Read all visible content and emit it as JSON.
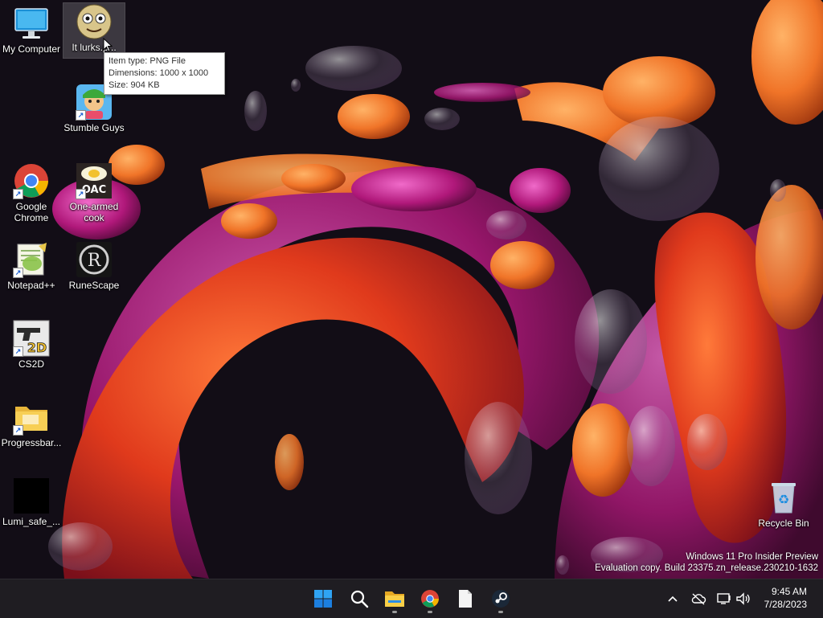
{
  "desktop": {
    "icons": [
      {
        "label": "My Computer"
      },
      {
        "label": "It lurks.p..."
      },
      {
        "label": "Stumble Guys"
      },
      {
        "label": "Google Chrome"
      },
      {
        "label": "One-armed cook"
      },
      {
        "label": "Notepad++"
      },
      {
        "label": "RuneScape"
      },
      {
        "label": "CS2D"
      },
      {
        "label": "Progressbar..."
      },
      {
        "label": "Lumi_safe_..."
      },
      {
        "label": "Recycle Bin"
      }
    ],
    "tooltip": {
      "line1": "Item type: PNG File",
      "line2": "Dimensions: 1000 x 1000",
      "line3": "Size: 904 KB"
    },
    "watermark": {
      "line1": "Windows 11 Pro Insider Preview",
      "line2": "Evaluation copy. Build 23375.zn_release.230210-1632"
    }
  },
  "taskbar": {
    "apps": [
      "start-icon",
      "search-icon",
      "file-explorer-icon",
      "chrome-icon",
      "notepad-icon",
      "steam-icon"
    ],
    "clock": {
      "time": "9:45 AM",
      "date": "7/28/2023"
    }
  },
  "colors": {
    "taskbar_bg": "#1f1d22",
    "accent": "#0078d4",
    "wallpaper_red": "#e2431e",
    "wallpaper_magenta": "#b0187a"
  }
}
